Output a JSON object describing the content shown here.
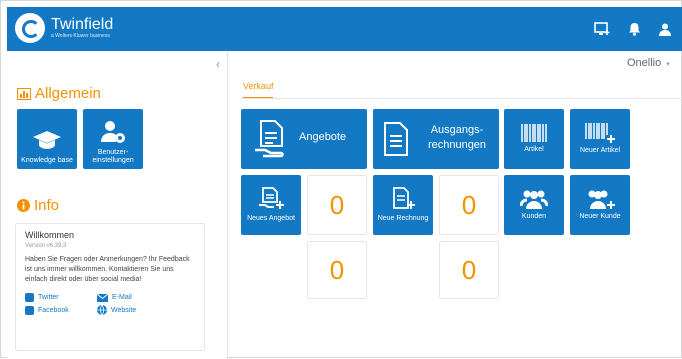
{
  "header": {
    "app_name": "Twinfield",
    "app_sub": "a Wolters Kluwer business"
  },
  "sidebar": {
    "collapse": "‹",
    "general_title": "Allgemein",
    "tiles": [
      {
        "label": "Knowledge base"
      },
      {
        "label": "Benutzer-einstellungen"
      }
    ],
    "info_title": "Info",
    "welcome": {
      "title": "Willkommen",
      "version": "Version v6.39.3",
      "text": "Haben Sie Fragen oder Anmerkungen? Ihr Feedback ist uns immer willkommen. Kontaktieren Sie uns einfach direkt oder über social media!"
    },
    "links": {
      "twitter": "Twitter",
      "email": "E-Mail",
      "facebook": "Facebook",
      "website": "Website"
    }
  },
  "main": {
    "user": "Onellio",
    "user_caret": "▾",
    "tab": "Verkauf",
    "tiles": {
      "angebote": "Angebote",
      "ausgangs": "Ausgangs-rechnungen",
      "artikel": "Artikel",
      "neuer_artikel": "Neuer Artikel",
      "neues_angebot": "Neues Angebot",
      "neue_rechnung": "Neue Rechnung",
      "kunden": "Kunden",
      "neuer_kunde": "Neuer Kunde"
    },
    "counts": [
      "0",
      "0",
      "0",
      "0"
    ]
  },
  "colors": {
    "primary": "#1479c4",
    "accent": "#f39200"
  }
}
